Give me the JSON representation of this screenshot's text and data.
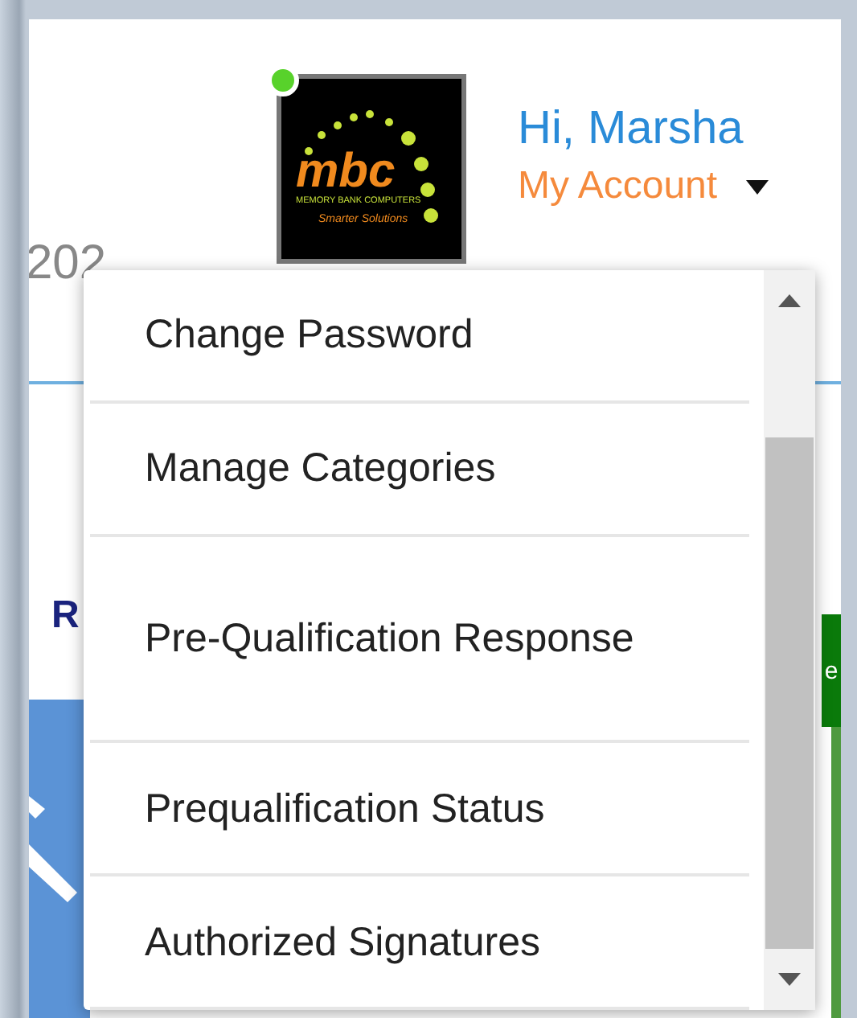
{
  "header": {
    "greeting": "Hi, Marsha",
    "account_link": "My Account",
    "online": true,
    "logo": {
      "wordmark": "mbc",
      "company": "MEMORY BANK COMPUTERS",
      "tagline": "Smarter Solutions"
    }
  },
  "background": {
    "year_fragment": "202",
    "left_fragment": "R",
    "right_fragment": "e"
  },
  "account_menu": {
    "items": [
      {
        "label": "Change Password"
      },
      {
        "label": "Manage Categories"
      },
      {
        "label": "Pre-Qualification Response"
      },
      {
        "label": "Prequalification Status"
      },
      {
        "label": "Authorized Signatures"
      }
    ]
  }
}
